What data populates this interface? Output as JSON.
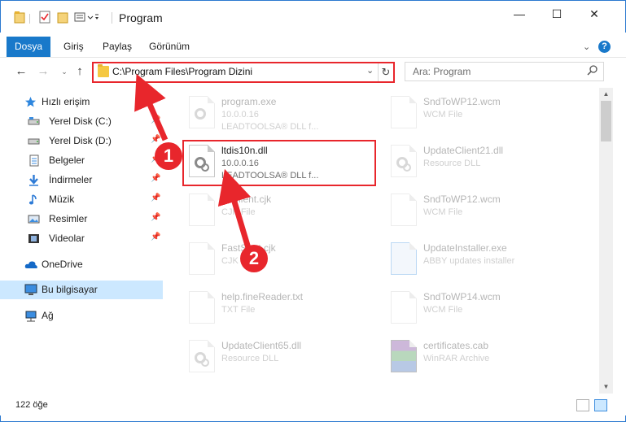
{
  "window": {
    "title": "Program",
    "minimize_glyph": "—",
    "maximize_glyph": "☐",
    "close_glyph": "✕"
  },
  "ribbon": {
    "tabs": [
      {
        "label": "Dosya"
      },
      {
        "label": "Giriş"
      },
      {
        "label": "Paylaş"
      },
      {
        "label": "Görünüm"
      }
    ],
    "help_label": "?"
  },
  "nav": {
    "address": "C:\\Program Files\\Program Dizini",
    "search_placeholder": "Ara: Program"
  },
  "sidebar": {
    "items": [
      {
        "label": "Hızlı erişim",
        "icon": "star-icon",
        "pinned": false
      },
      {
        "label": "Yerel Disk (C:)",
        "icon": "drive-icon",
        "pinned": true
      },
      {
        "label": "Yerel Disk (D:)",
        "icon": "drive-icon",
        "pinned": true
      },
      {
        "label": "Belgeler",
        "icon": "documents-icon",
        "pinned": true
      },
      {
        "label": "İndirmeler",
        "icon": "downloads-icon",
        "pinned": true
      },
      {
        "label": "Müzik",
        "icon": "music-icon",
        "pinned": true
      },
      {
        "label": "Resimler",
        "icon": "pictures-icon",
        "pinned": true
      },
      {
        "label": "Videolar",
        "icon": "videos-icon",
        "pinned": true
      },
      {
        "label": "OneDrive",
        "icon": "cloud-icon",
        "pinned": false
      },
      {
        "label": "Bu bilgisayar",
        "icon": "computer-icon",
        "pinned": false
      },
      {
        "label": "Ağ",
        "icon": "network-icon",
        "pinned": false
      }
    ]
  },
  "files": {
    "left": [
      {
        "name": "program.exe",
        "line2": "10.0.0.16",
        "line3": "LEADTOOLSA® DLL f...",
        "icon": "exe-icon",
        "faded": true
      },
      {
        "name": "ltdis10n.dll",
        "line2": "10.0.0.16",
        "line3": "LEADTOOLSA® DLL f...",
        "icon": "dll-icon",
        "faded": false
      },
      {
        "name": "ffcClient.cjk",
        "line2": "CJK File",
        "line3": "",
        "icon": "file-icon",
        "faded": true
      },
      {
        "name": "FastStart.cjk",
        "line2": "CJK File",
        "line3": "",
        "icon": "file-icon",
        "faded": true
      },
      {
        "name": "help.fineReader.txt",
        "line2": "TXT File",
        "line3": "",
        "icon": "file-icon",
        "faded": true
      },
      {
        "name": "UpdateClient65.dll",
        "line2": "Resource DLL",
        "line3": "",
        "icon": "dll-icon",
        "faded": true
      }
    ],
    "right": [
      {
        "name": "SndToWP12.wcm",
        "line2": "WCM File",
        "line3": "",
        "icon": "file-icon",
        "faded": true
      },
      {
        "name": "UpdateClient21.dll",
        "line2": "Resource DLL",
        "line3": "",
        "icon": "dll-icon",
        "faded": true
      },
      {
        "name": "SndToWP12.wcm",
        "line2": "WCM File",
        "line3": "",
        "icon": "file-icon",
        "faded": true
      },
      {
        "name": "UpdateInstaller.exe",
        "line2": "ABBY updates installer",
        "line3": "",
        "icon": "installer-icon",
        "faded": true
      },
      {
        "name": "SndToWP14.wcm",
        "line2": "WCM File",
        "line3": "",
        "icon": "file-icon",
        "faded": true
      },
      {
        "name": "certificates.cab",
        "line2": "WinRAR Archive",
        "line3": "",
        "icon": "archive-icon",
        "faded": true
      }
    ]
  },
  "annotations": {
    "badge1": "1",
    "badge2": "2",
    "color": "#e8262c"
  },
  "status": {
    "count": "122 öğe"
  }
}
